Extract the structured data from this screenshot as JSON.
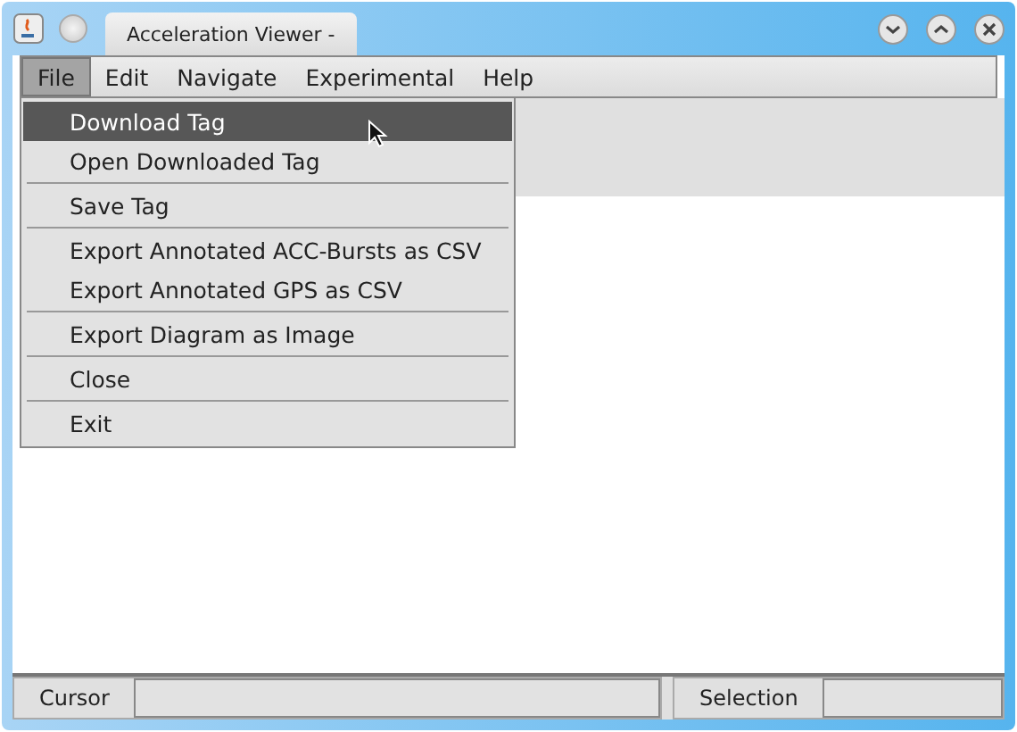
{
  "window": {
    "tab_title": "Acceleration Viewer -"
  },
  "menu_bar": [
    {
      "label": "File",
      "selected": true
    },
    {
      "label": "Edit",
      "selected": false
    },
    {
      "label": "Navigate",
      "selected": false
    },
    {
      "label": "Experimental",
      "selected": false
    },
    {
      "label": "Help",
      "selected": false
    }
  ],
  "file_menu": [
    {
      "kind": "item",
      "label": "Download Tag",
      "selected": true
    },
    {
      "kind": "item",
      "label": "Open Downloaded Tag",
      "selected": false
    },
    {
      "kind": "separator"
    },
    {
      "kind": "item",
      "label": "Save Tag",
      "selected": false
    },
    {
      "kind": "separator"
    },
    {
      "kind": "item",
      "label": "Export Annotated ACC-Bursts as CSV",
      "selected": false
    },
    {
      "kind": "item",
      "label": "Export Annotated GPS as CSV",
      "selected": false
    },
    {
      "kind": "separator"
    },
    {
      "kind": "item",
      "label": "Export Diagram as Image",
      "selected": false
    },
    {
      "kind": "separator"
    },
    {
      "kind": "item",
      "label": "Close",
      "selected": false
    },
    {
      "kind": "separator"
    },
    {
      "kind": "item",
      "label": "Exit",
      "selected": false
    }
  ],
  "status_bar": {
    "cursor_label": "Cursor",
    "selection_label": "Selection"
  }
}
